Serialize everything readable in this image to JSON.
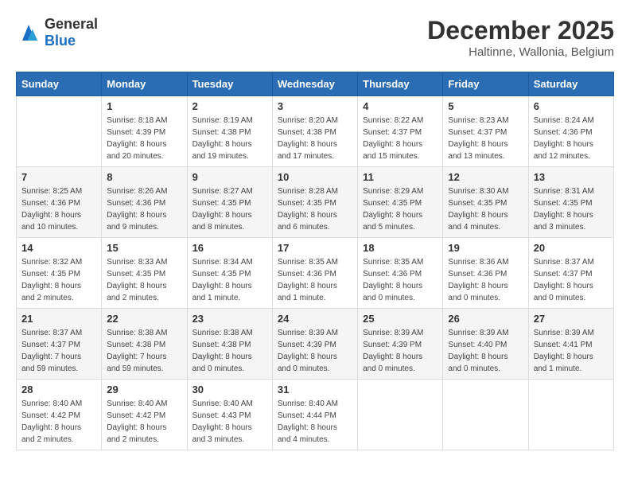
{
  "header": {
    "logo_general": "General",
    "logo_blue": "Blue",
    "month": "December 2025",
    "location": "Haltinne, Wallonia, Belgium"
  },
  "weekdays": [
    "Sunday",
    "Monday",
    "Tuesday",
    "Wednesday",
    "Thursday",
    "Friday",
    "Saturday"
  ],
  "weeks": [
    [
      {
        "day": "",
        "sunrise": "",
        "sunset": "",
        "daylight": ""
      },
      {
        "day": "1",
        "sunrise": "Sunrise: 8:18 AM",
        "sunset": "Sunset: 4:39 PM",
        "daylight": "Daylight: 8 hours and 20 minutes."
      },
      {
        "day": "2",
        "sunrise": "Sunrise: 8:19 AM",
        "sunset": "Sunset: 4:38 PM",
        "daylight": "Daylight: 8 hours and 19 minutes."
      },
      {
        "day": "3",
        "sunrise": "Sunrise: 8:20 AM",
        "sunset": "Sunset: 4:38 PM",
        "daylight": "Daylight: 8 hours and 17 minutes."
      },
      {
        "day": "4",
        "sunrise": "Sunrise: 8:22 AM",
        "sunset": "Sunset: 4:37 PM",
        "daylight": "Daylight: 8 hours and 15 minutes."
      },
      {
        "day": "5",
        "sunrise": "Sunrise: 8:23 AM",
        "sunset": "Sunset: 4:37 PM",
        "daylight": "Daylight: 8 hours and 13 minutes."
      },
      {
        "day": "6",
        "sunrise": "Sunrise: 8:24 AM",
        "sunset": "Sunset: 4:36 PM",
        "daylight": "Daylight: 8 hours and 12 minutes."
      }
    ],
    [
      {
        "day": "7",
        "sunrise": "Sunrise: 8:25 AM",
        "sunset": "Sunset: 4:36 PM",
        "daylight": "Daylight: 8 hours and 10 minutes."
      },
      {
        "day": "8",
        "sunrise": "Sunrise: 8:26 AM",
        "sunset": "Sunset: 4:36 PM",
        "daylight": "Daylight: 8 hours and 9 minutes."
      },
      {
        "day": "9",
        "sunrise": "Sunrise: 8:27 AM",
        "sunset": "Sunset: 4:35 PM",
        "daylight": "Daylight: 8 hours and 8 minutes."
      },
      {
        "day": "10",
        "sunrise": "Sunrise: 8:28 AM",
        "sunset": "Sunset: 4:35 PM",
        "daylight": "Daylight: 8 hours and 6 minutes."
      },
      {
        "day": "11",
        "sunrise": "Sunrise: 8:29 AM",
        "sunset": "Sunset: 4:35 PM",
        "daylight": "Daylight: 8 hours and 5 minutes."
      },
      {
        "day": "12",
        "sunrise": "Sunrise: 8:30 AM",
        "sunset": "Sunset: 4:35 PM",
        "daylight": "Daylight: 8 hours and 4 minutes."
      },
      {
        "day": "13",
        "sunrise": "Sunrise: 8:31 AM",
        "sunset": "Sunset: 4:35 PM",
        "daylight": "Daylight: 8 hours and 3 minutes."
      }
    ],
    [
      {
        "day": "14",
        "sunrise": "Sunrise: 8:32 AM",
        "sunset": "Sunset: 4:35 PM",
        "daylight": "Daylight: 8 hours and 2 minutes."
      },
      {
        "day": "15",
        "sunrise": "Sunrise: 8:33 AM",
        "sunset": "Sunset: 4:35 PM",
        "daylight": "Daylight: 8 hours and 2 minutes."
      },
      {
        "day": "16",
        "sunrise": "Sunrise: 8:34 AM",
        "sunset": "Sunset: 4:35 PM",
        "daylight": "Daylight: 8 hours and 1 minute."
      },
      {
        "day": "17",
        "sunrise": "Sunrise: 8:35 AM",
        "sunset": "Sunset: 4:36 PM",
        "daylight": "Daylight: 8 hours and 1 minute."
      },
      {
        "day": "18",
        "sunrise": "Sunrise: 8:35 AM",
        "sunset": "Sunset: 4:36 PM",
        "daylight": "Daylight: 8 hours and 0 minutes."
      },
      {
        "day": "19",
        "sunrise": "Sunrise: 8:36 AM",
        "sunset": "Sunset: 4:36 PM",
        "daylight": "Daylight: 8 hours and 0 minutes."
      },
      {
        "day": "20",
        "sunrise": "Sunrise: 8:37 AM",
        "sunset": "Sunset: 4:37 PM",
        "daylight": "Daylight: 8 hours and 0 minutes."
      }
    ],
    [
      {
        "day": "21",
        "sunrise": "Sunrise: 8:37 AM",
        "sunset": "Sunset: 4:37 PM",
        "daylight": "Daylight: 7 hours and 59 minutes."
      },
      {
        "day": "22",
        "sunrise": "Sunrise: 8:38 AM",
        "sunset": "Sunset: 4:38 PM",
        "daylight": "Daylight: 7 hours and 59 minutes."
      },
      {
        "day": "23",
        "sunrise": "Sunrise: 8:38 AM",
        "sunset": "Sunset: 4:38 PM",
        "daylight": "Daylight: 8 hours and 0 minutes."
      },
      {
        "day": "24",
        "sunrise": "Sunrise: 8:39 AM",
        "sunset": "Sunset: 4:39 PM",
        "daylight": "Daylight: 8 hours and 0 minutes."
      },
      {
        "day": "25",
        "sunrise": "Sunrise: 8:39 AM",
        "sunset": "Sunset: 4:39 PM",
        "daylight": "Daylight: 8 hours and 0 minutes."
      },
      {
        "day": "26",
        "sunrise": "Sunrise: 8:39 AM",
        "sunset": "Sunset: 4:40 PM",
        "daylight": "Daylight: 8 hours and 0 minutes."
      },
      {
        "day": "27",
        "sunrise": "Sunrise: 8:39 AM",
        "sunset": "Sunset: 4:41 PM",
        "daylight": "Daylight: 8 hours and 1 minute."
      }
    ],
    [
      {
        "day": "28",
        "sunrise": "Sunrise: 8:40 AM",
        "sunset": "Sunset: 4:42 PM",
        "daylight": "Daylight: 8 hours and 2 minutes."
      },
      {
        "day": "29",
        "sunrise": "Sunrise: 8:40 AM",
        "sunset": "Sunset: 4:42 PM",
        "daylight": "Daylight: 8 hours and 2 minutes."
      },
      {
        "day": "30",
        "sunrise": "Sunrise: 8:40 AM",
        "sunset": "Sunset: 4:43 PM",
        "daylight": "Daylight: 8 hours and 3 minutes."
      },
      {
        "day": "31",
        "sunrise": "Sunrise: 8:40 AM",
        "sunset": "Sunset: 4:44 PM",
        "daylight": "Daylight: 8 hours and 4 minutes."
      },
      {
        "day": "",
        "sunrise": "",
        "sunset": "",
        "daylight": ""
      },
      {
        "day": "",
        "sunrise": "",
        "sunset": "",
        "daylight": ""
      },
      {
        "day": "",
        "sunrise": "",
        "sunset": "",
        "daylight": ""
      }
    ]
  ]
}
